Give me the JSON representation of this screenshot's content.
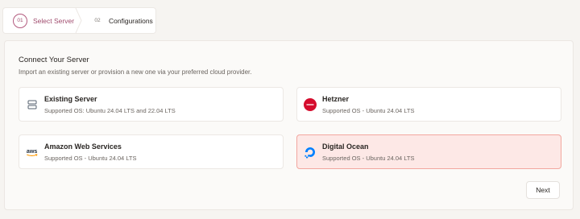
{
  "stepper": {
    "steps": [
      {
        "number": "01",
        "label": "Select Server",
        "active": true
      },
      {
        "number": "02",
        "label": "Configurations",
        "active": false
      }
    ]
  },
  "main": {
    "title": "Connect Your Server",
    "subtitle": "Import an existing server or provision a new one via your preferred cloud provider.",
    "options": [
      {
        "title": "Existing Server",
        "description": "Supported OS: Ubuntu 24.04 LTS and 22.04 LTS",
        "icon": "server-icon",
        "selected": false
      },
      {
        "title": "Hetzner",
        "description": "Supported OS - Ubuntu 24.04 LTS",
        "icon": "hetzner-logo",
        "selected": false
      },
      {
        "title": "Amazon Web Services",
        "description": "Supported OS - Ubuntu 24.04 LTS",
        "icon": "aws-logo",
        "logo_text": "aws",
        "selected": false
      },
      {
        "title": "Digital Ocean",
        "description": "Supported OS - Ubuntu 24.04 LTS",
        "icon": "digitalocean-logo",
        "selected": true
      }
    ],
    "next_label": "Next"
  },
  "colors": {
    "accent": "#a04c6e",
    "selected_bg": "#fde8e6",
    "selected_border": "#f2a79f",
    "hetzner": "#d50c2d",
    "digitalocean": "#0080ff",
    "aws_smile": "#ff9900"
  }
}
